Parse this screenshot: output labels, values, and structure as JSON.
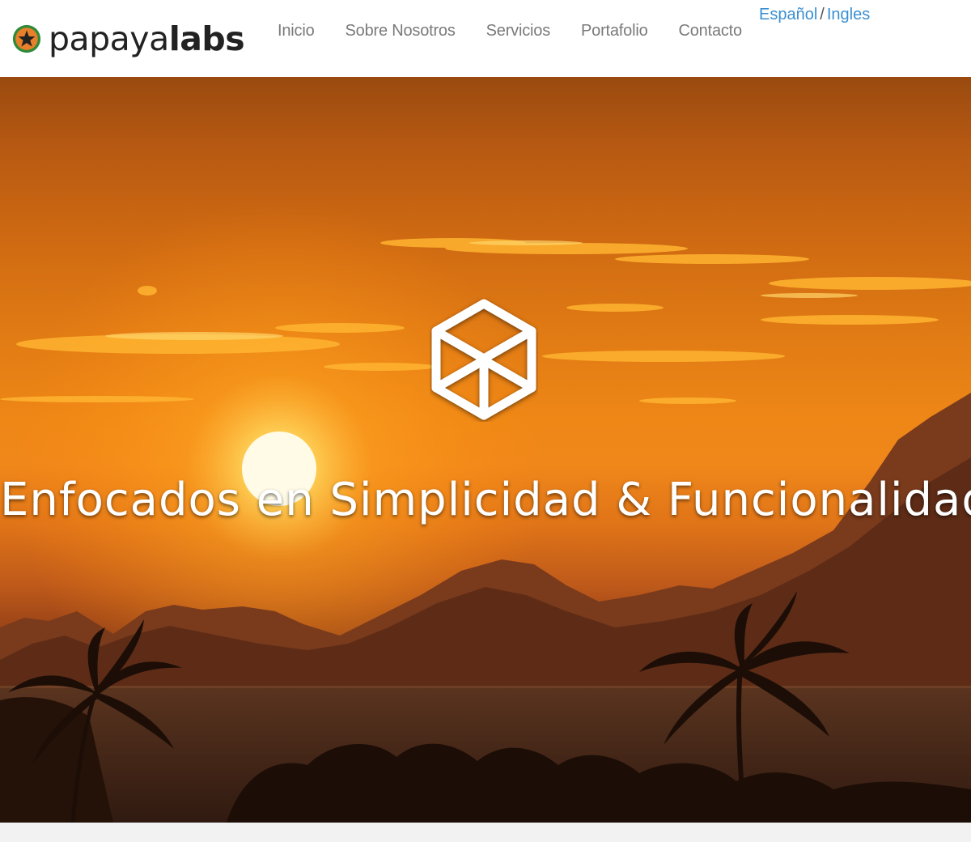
{
  "brand": {
    "name_light": "papaya",
    "name_bold": "labs",
    "badge_icon": "star-badge-icon",
    "badge_colors": [
      "#e8802a",
      "#2f8a3a",
      "#222222"
    ]
  },
  "nav": {
    "items": [
      {
        "label": "Inicio"
      },
      {
        "label": "Sobre Nosotros"
      },
      {
        "label": "Servicios"
      },
      {
        "label": "Portafolio"
      },
      {
        "label": "Contacto"
      }
    ]
  },
  "language": {
    "spanish": "Español",
    "separator": "/",
    "english": "Ingles",
    "link_color": "#3a8fd1"
  },
  "hero": {
    "background": "sunset-over-bay-photo",
    "logo_icon": "cube-outline-icon",
    "tagline": "Enfocados en Simplicidad & Funcionalidad"
  },
  "colors": {
    "nav_text": "#7a7a7a",
    "sky_orange": "#ee8716",
    "silhouette": "#3a1d12"
  }
}
